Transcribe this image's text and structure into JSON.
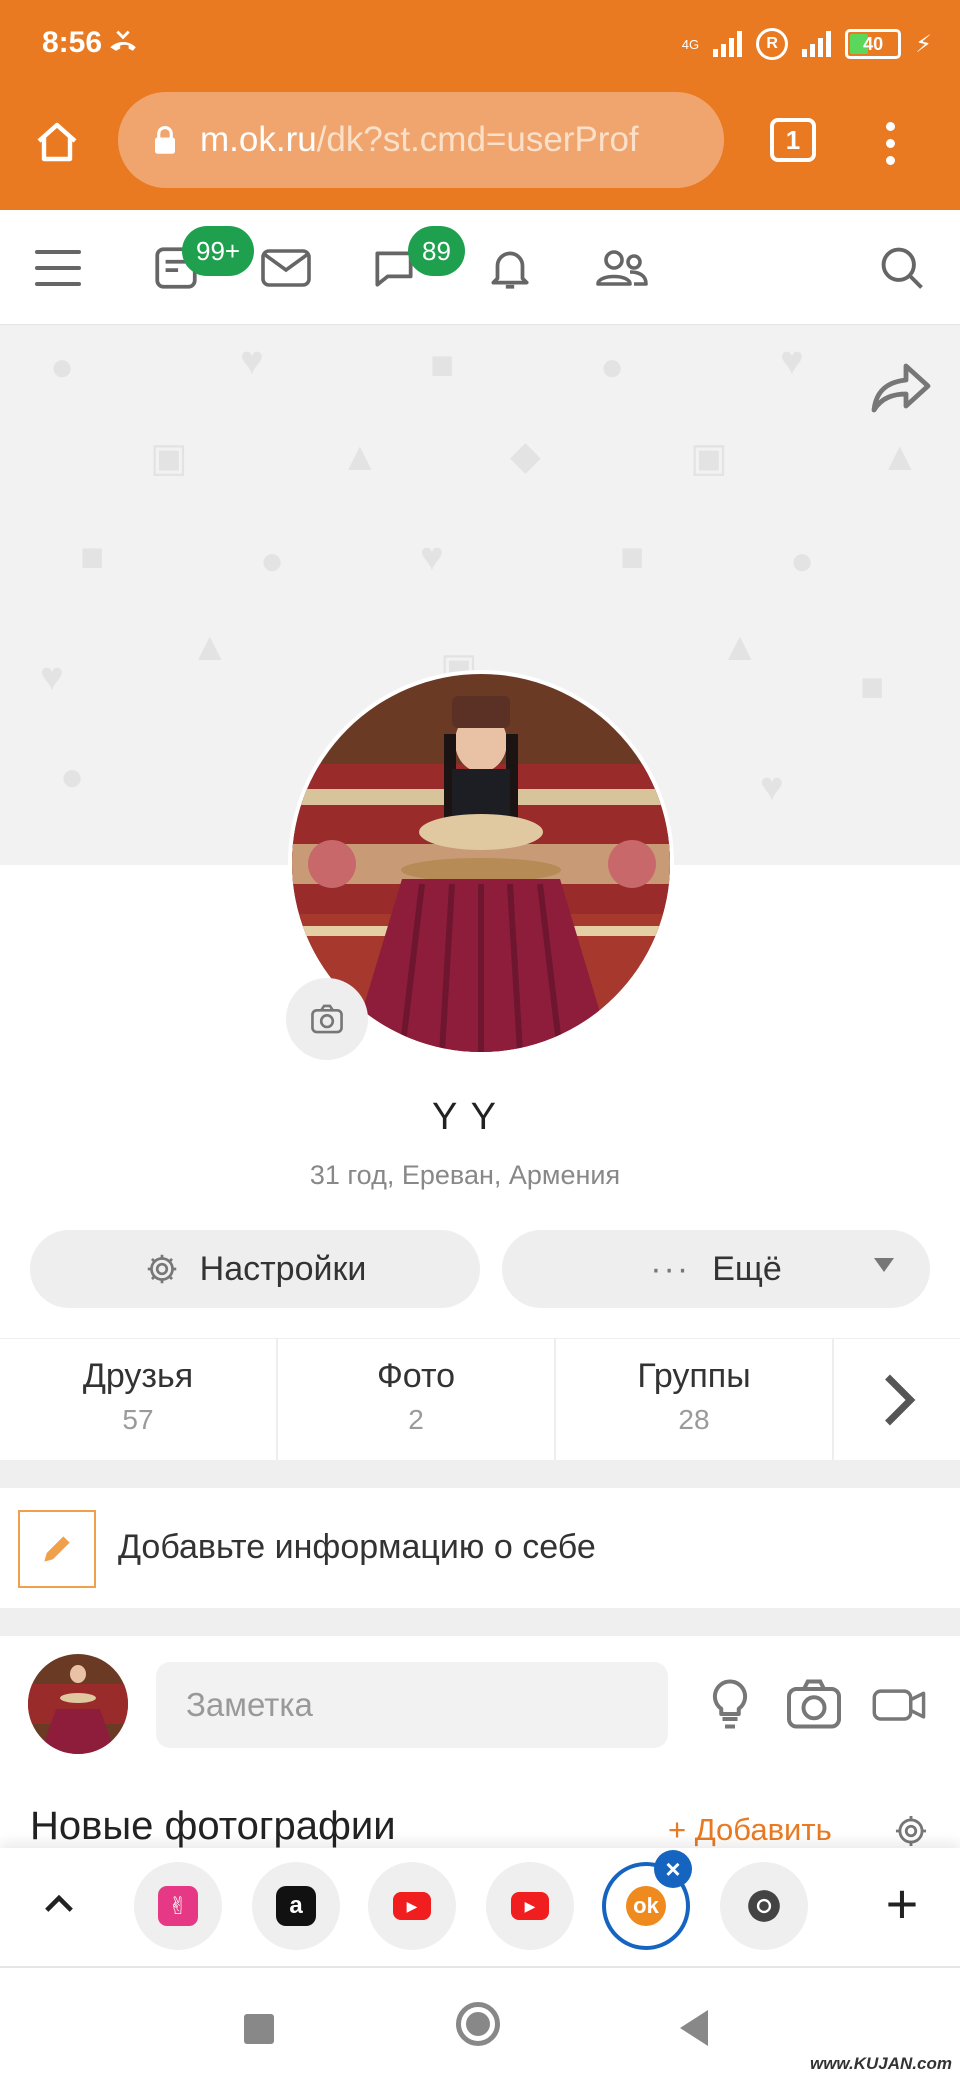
{
  "status_bar": {
    "time": "8:56",
    "network": "4G",
    "roaming": "R",
    "battery": "40",
    "battery_level_percent": 40
  },
  "browser": {
    "url_host": "m.ok.ru",
    "url_path": "/dk?st.cmd=userProf",
    "tabs_count": "1"
  },
  "nav": {
    "feed_badge": "99+",
    "discussions_badge": "89"
  },
  "profile": {
    "name": "Y Y",
    "info": "31 год, Ереван, Армения"
  },
  "actions": {
    "settings_label": "Настройки",
    "more_label": "Ещё"
  },
  "stats": [
    {
      "label": "Друзья",
      "value": "57"
    },
    {
      "label": "Фото",
      "value": "2"
    },
    {
      "label": "Группы",
      "value": "28"
    }
  ],
  "about": {
    "text": "Добавьте информацию о себе"
  },
  "composer": {
    "placeholder": "Заметка"
  },
  "photos_section": {
    "title": "Новые фотографии",
    "add_label": "+ Добавить"
  },
  "watermark": "www.KUJAN.com",
  "colors": {
    "accent": "#e97a22",
    "badge": "#1fa04e",
    "active_tab": "#1565c0"
  }
}
